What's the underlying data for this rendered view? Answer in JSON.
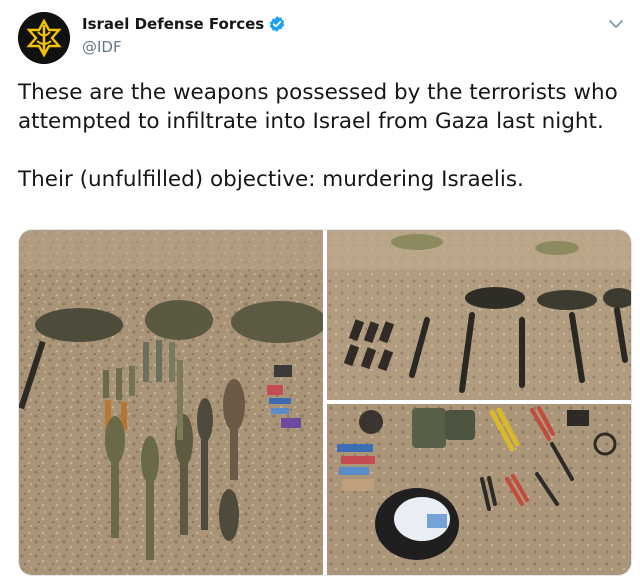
{
  "account": {
    "display_name": "Israel Defense Forces",
    "handle": "@IDF",
    "avatar_icon": "idf-emblem-icon",
    "verified_icon": "verified-badge-icon",
    "verified_color": "#1da1f2"
  },
  "menu_icon": "chevron-down-icon",
  "tweet": {
    "line1": "These are the weapons possessed by the terrorists who",
    "line2": "attempted to infiltrate into Israel from Gaza last night.",
    "line3": "Their (unfulfilled) objective: murdering Israelis."
  },
  "colors": {
    "text": "#14171a",
    "secondary_text": "#657786",
    "emblem": "#f5c400"
  }
}
